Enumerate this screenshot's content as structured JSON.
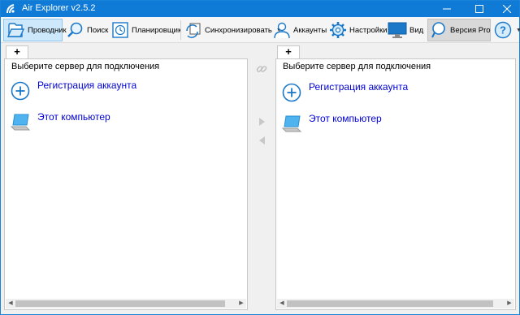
{
  "window": {
    "title": "Air Explorer v2.5.2"
  },
  "toolbar": {
    "explorer": "Проводник",
    "search": "Поиск",
    "scheduler": "Планировщик",
    "sync": "Синхронизировать",
    "accounts": "Аккаунты",
    "settings": "Настройки",
    "view": "Вид",
    "pro": "Версия Pro",
    "help_icon": "help-icon"
  },
  "panels": {
    "left": {
      "tab": "+",
      "header": "Выберите сервер для подключения",
      "items": [
        {
          "icon": "add-account-icon",
          "label": "Регистрация аккаунта"
        },
        {
          "icon": "computer-icon",
          "label": "Этот компьютер"
        }
      ]
    },
    "right": {
      "tab": "+",
      "header": "Выберите сервер для подключения",
      "items": [
        {
          "icon": "add-account-icon",
          "label": "Регистрация аккаунта"
        },
        {
          "icon": "computer-icon",
          "label": "Этот компьютер"
        }
      ]
    }
  },
  "colors": {
    "titlebar": "#0f7bd6",
    "link": "#0000d8",
    "accent": "#1883d7"
  }
}
